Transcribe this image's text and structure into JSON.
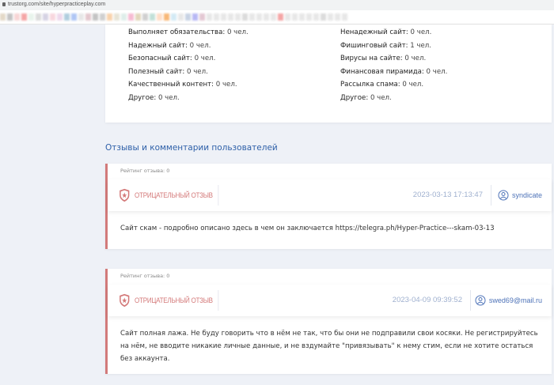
{
  "browser": {
    "url": "trustorg.com/site/hyperpracticeplay.com"
  },
  "stats": {
    "left": [
      {
        "label": "Выполняет обязательства:",
        "value": "0 чел."
      },
      {
        "label": "Надежный сайт:",
        "value": "0 чел."
      },
      {
        "label": "Безопасный сайт:",
        "value": "0 чел."
      },
      {
        "label": "Полезный сайт:",
        "value": "0 чел."
      },
      {
        "label": "Качественный контент:",
        "value": "0 чел."
      },
      {
        "label": "Другое:",
        "value": "0 чел."
      }
    ],
    "right": [
      {
        "label": "Ненадежный сайт:",
        "value": "0 чел."
      },
      {
        "label": "Фишинговый сайт:",
        "value": "1 чел."
      },
      {
        "label": "Вирусы на сайте:",
        "value": "0 чел."
      },
      {
        "label": "Финансовая пирамида:",
        "value": "0 чел."
      },
      {
        "label": "Рассылка спама:",
        "value": "0 чел."
      },
      {
        "label": "Другое:",
        "value": "0 чел."
      }
    ]
  },
  "reviews_heading": "Отзывы и комментарии пользователей",
  "reviews": [
    {
      "rating": "Рейтинг отзыва: 0",
      "type": "ОТРИЦАТЕЛЬНЫЙ ОТЗЫВ",
      "date": "2023-03-13 17:13:47",
      "user": "syndicate",
      "text": "Сайт скам - подробно описано здесь в чем он заключается https://telegra.ph/Hyper-Practice---skam-03-13"
    },
    {
      "rating": "Рейтинг отзыва: 0",
      "type": "ОТРИЦАТЕЛЬНЫЙ ОТЗЫВ",
      "date": "2023-04-09 09:39:52",
      "user": "swed69@mail.ru",
      "text": "Сайт полная лажа. Не буду говорить что в нём не так, что бы они не подправили свои косяки. Не регистрируйтесь на нём, не вводите никакие личные данные, и не вздумайте \"привязывать\" к нему стим, если не хотите остаться без аккаунта."
    }
  ],
  "colors": {
    "accent": "#2d5fa8",
    "negative": "#d47a7a"
  }
}
